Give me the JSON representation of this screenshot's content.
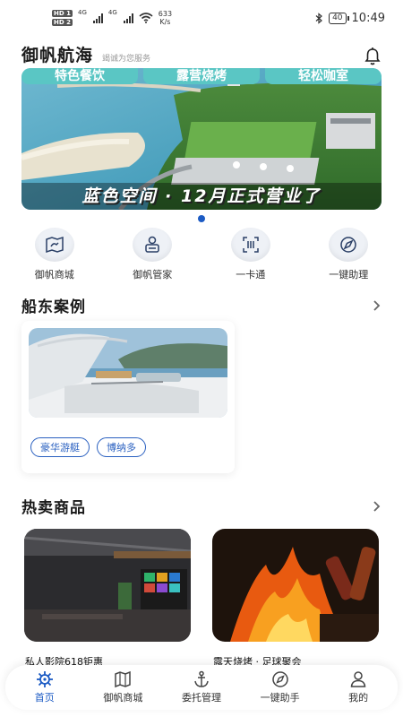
{
  "status_bar": {
    "sim1": "HD 1",
    "sim2": "HD 2",
    "net1": "4G",
    "net2": "4G",
    "speed_value": "633",
    "speed_unit": "K/s",
    "battery": "40",
    "time": "10:49"
  },
  "header": {
    "title": "御帆航海",
    "subtitle": "竭诚为您服务"
  },
  "banner": {
    "top_labels": [
      "特色餐饮",
      "露营烧烤",
      "轻松咖室"
    ],
    "caption": "蓝色空间 · 12月正式营业了",
    "active_index": 0,
    "count": 1
  },
  "quick_actions": [
    {
      "label": "御帆商城",
      "icon": "map-icon"
    },
    {
      "label": "御帆管家",
      "icon": "butler-icon"
    },
    {
      "label": "一卡通",
      "icon": "scan-icon"
    },
    {
      "label": "一键助理",
      "icon": "compass-icon"
    }
  ],
  "cases": {
    "title": "船东案例",
    "items": [
      {
        "tags": [
          "豪华游艇",
          "博纳多"
        ]
      }
    ]
  },
  "hot": {
    "title": "热卖商品",
    "items": [
      {
        "name": "私人影院618钜惠"
      },
      {
        "name": "露天烧烤 · 足球聚会"
      }
    ]
  },
  "bottom_nav": [
    {
      "label": "首页",
      "icon": "helm-icon",
      "active": true
    },
    {
      "label": "御帆商城",
      "icon": "map-icon",
      "active": false
    },
    {
      "label": "委托管理",
      "icon": "anchor-icon",
      "active": false
    },
    {
      "label": "一键助手",
      "icon": "compass-icon",
      "active": false
    },
    {
      "label": "我的",
      "icon": "user-icon",
      "active": false
    }
  ],
  "colors": {
    "accent": "#1c5bc4",
    "banner_label_bg": "#5ac6c4",
    "tag": "#2a60c0"
  }
}
